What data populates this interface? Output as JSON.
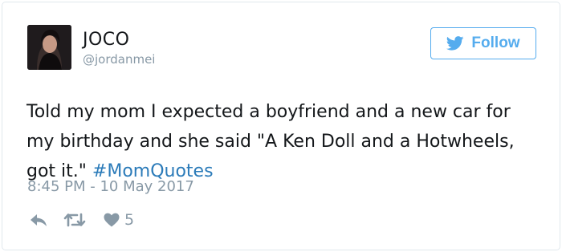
{
  "author": {
    "name": "JOCO",
    "handle": "@jordanmei"
  },
  "follow_button": {
    "label": "Follow",
    "icon": "twitter-bird-icon"
  },
  "tweet": {
    "text": "Told my mom I expected a boyfriend and a new car for my birthday and she said \"A Ken Doll and a Hotwheels, got it.\"",
    "hashtag": "#MomQuotes",
    "timestamp": "8:45 PM - 10 May 2017"
  },
  "actions": {
    "reply_icon": "reply-icon",
    "retweet_icon": "retweet-icon",
    "like_icon": "heart-icon",
    "like_count": "5"
  },
  "colors": {
    "accent": "#55acee",
    "hashtag": "#2b7bb9",
    "muted": "#8899a6",
    "text": "#14171a",
    "border": "#e1e8ed"
  }
}
